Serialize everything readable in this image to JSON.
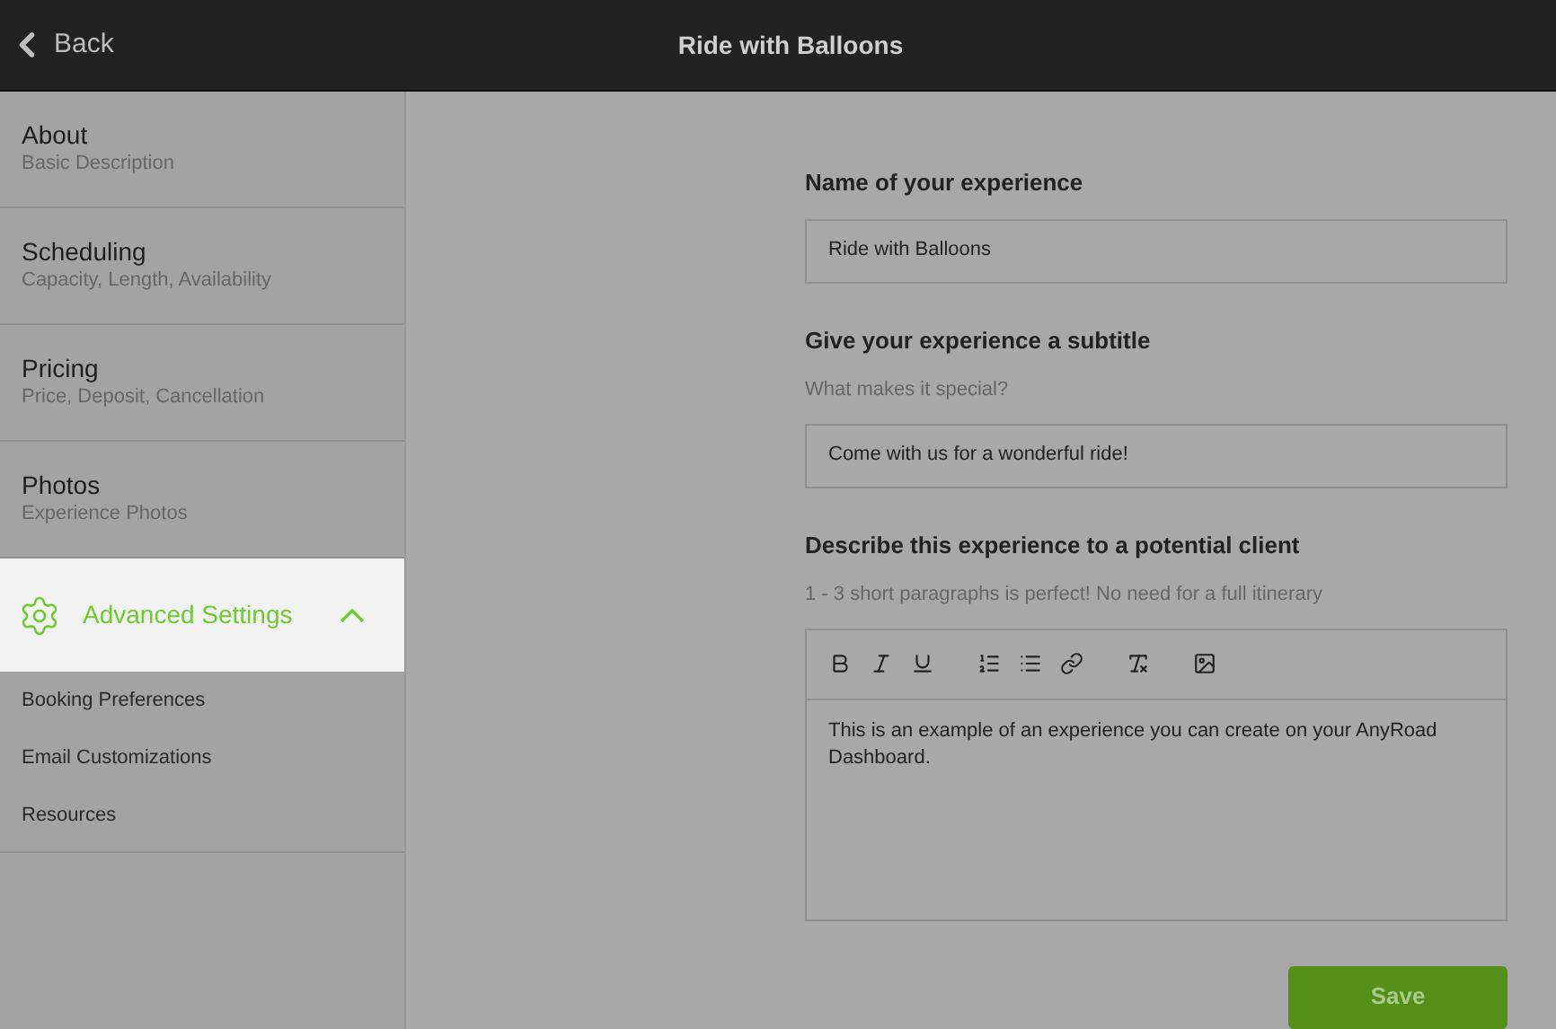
{
  "header": {
    "back": "Back",
    "title": "Ride with Balloons"
  },
  "sidebar": {
    "items": [
      {
        "kind": "section",
        "title": "About",
        "subtitle": "Basic Description",
        "selected": false
      },
      {
        "kind": "section",
        "title": "Scheduling",
        "subtitle": "Capacity, Length, Availability",
        "selected": false
      },
      {
        "kind": "section",
        "title": "Pricing",
        "subtitle": "Price, Deposit, Cancellation",
        "selected": false
      },
      {
        "kind": "section",
        "title": "Photos",
        "subtitle": "Experience Photos",
        "selected": false
      },
      {
        "kind": "group",
        "title": "Advanced Settings",
        "selected": true,
        "expanded": true,
        "children": [
          {
            "title": "Booking Preferences"
          },
          {
            "title": "Email Customizations"
          },
          {
            "title": "Resources"
          }
        ]
      }
    ]
  },
  "form": {
    "fields": [
      {
        "kind": "input",
        "label": "Name of your experience",
        "value": "Ride with Balloons"
      },
      {
        "kind": "input",
        "label": "Give your experience a subtitle",
        "hint": "What makes it special?",
        "value": "Come with us for a wonderful ride!"
      },
      {
        "kind": "editor",
        "label": "Describe this experience to a potential client",
        "hint": "1 - 3 short paragraphs is perfect! No need for a full itinerary",
        "value": "This is an example of an experience you can create on your AnyRoad Dashboard."
      }
    ],
    "save": "Save"
  }
}
